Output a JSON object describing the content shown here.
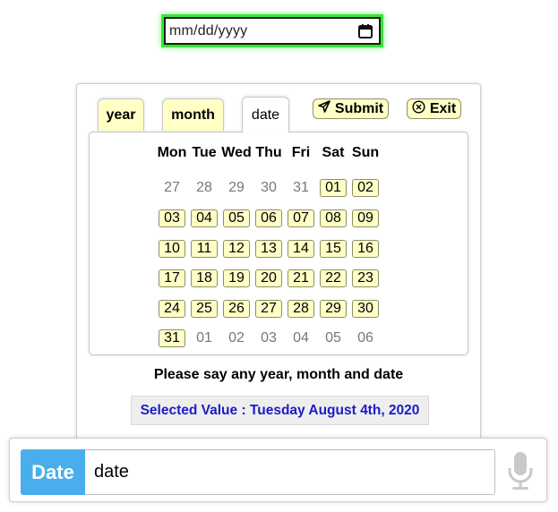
{
  "date_input": {
    "placeholder": "mm/dd/yyyy",
    "icon": "calendar-icon"
  },
  "tabs": [
    {
      "label": "year",
      "active": false
    },
    {
      "label": "month",
      "active": false
    },
    {
      "label": "date",
      "active": true
    }
  ],
  "actions": {
    "submit_label": "Submit",
    "exit_label": "Exit"
  },
  "calendar": {
    "weekdays": [
      "Mon",
      "Tue",
      "Wed",
      "Thu",
      "Fri",
      "Sat",
      "Sun"
    ],
    "days": [
      {
        "d": "27",
        "in": false
      },
      {
        "d": "28",
        "in": false
      },
      {
        "d": "29",
        "in": false
      },
      {
        "d": "30",
        "in": false
      },
      {
        "d": "31",
        "in": false
      },
      {
        "d": "01",
        "in": true
      },
      {
        "d": "02",
        "in": true
      },
      {
        "d": "03",
        "in": true
      },
      {
        "d": "04",
        "in": true
      },
      {
        "d": "05",
        "in": true
      },
      {
        "d": "06",
        "in": true
      },
      {
        "d": "07",
        "in": true
      },
      {
        "d": "08",
        "in": true
      },
      {
        "d": "09",
        "in": true
      },
      {
        "d": "10",
        "in": true
      },
      {
        "d": "11",
        "in": true
      },
      {
        "d": "12",
        "in": true
      },
      {
        "d": "13",
        "in": true
      },
      {
        "d": "14",
        "in": true
      },
      {
        "d": "15",
        "in": true
      },
      {
        "d": "16",
        "in": true
      },
      {
        "d": "17",
        "in": true
      },
      {
        "d": "18",
        "in": true
      },
      {
        "d": "19",
        "in": true
      },
      {
        "d": "20",
        "in": true
      },
      {
        "d": "21",
        "in": true
      },
      {
        "d": "22",
        "in": true
      },
      {
        "d": "23",
        "in": true
      },
      {
        "d": "24",
        "in": true
      },
      {
        "d": "25",
        "in": true
      },
      {
        "d": "26",
        "in": true
      },
      {
        "d": "27",
        "in": true
      },
      {
        "d": "28",
        "in": true
      },
      {
        "d": "29",
        "in": true
      },
      {
        "d": "30",
        "in": true
      },
      {
        "d": "31",
        "in": true
      },
      {
        "d": "01",
        "in": false
      },
      {
        "d": "02",
        "in": false
      },
      {
        "d": "03",
        "in": false
      },
      {
        "d": "04",
        "in": false
      },
      {
        "d": "05",
        "in": false
      },
      {
        "d": "06",
        "in": false
      }
    ]
  },
  "prompt": "Please say any year, month and date",
  "selected_value": "Selected Value : Tuesday August 4th, 2020",
  "input_bar": {
    "label": "Date",
    "value": "date",
    "mic_icon": "microphone-icon"
  },
  "colors": {
    "chip_bg": "#ffffc6",
    "accent_blue": "#49aeec",
    "selected_text": "#1c1cc8",
    "focus_glow": "#35e635"
  }
}
